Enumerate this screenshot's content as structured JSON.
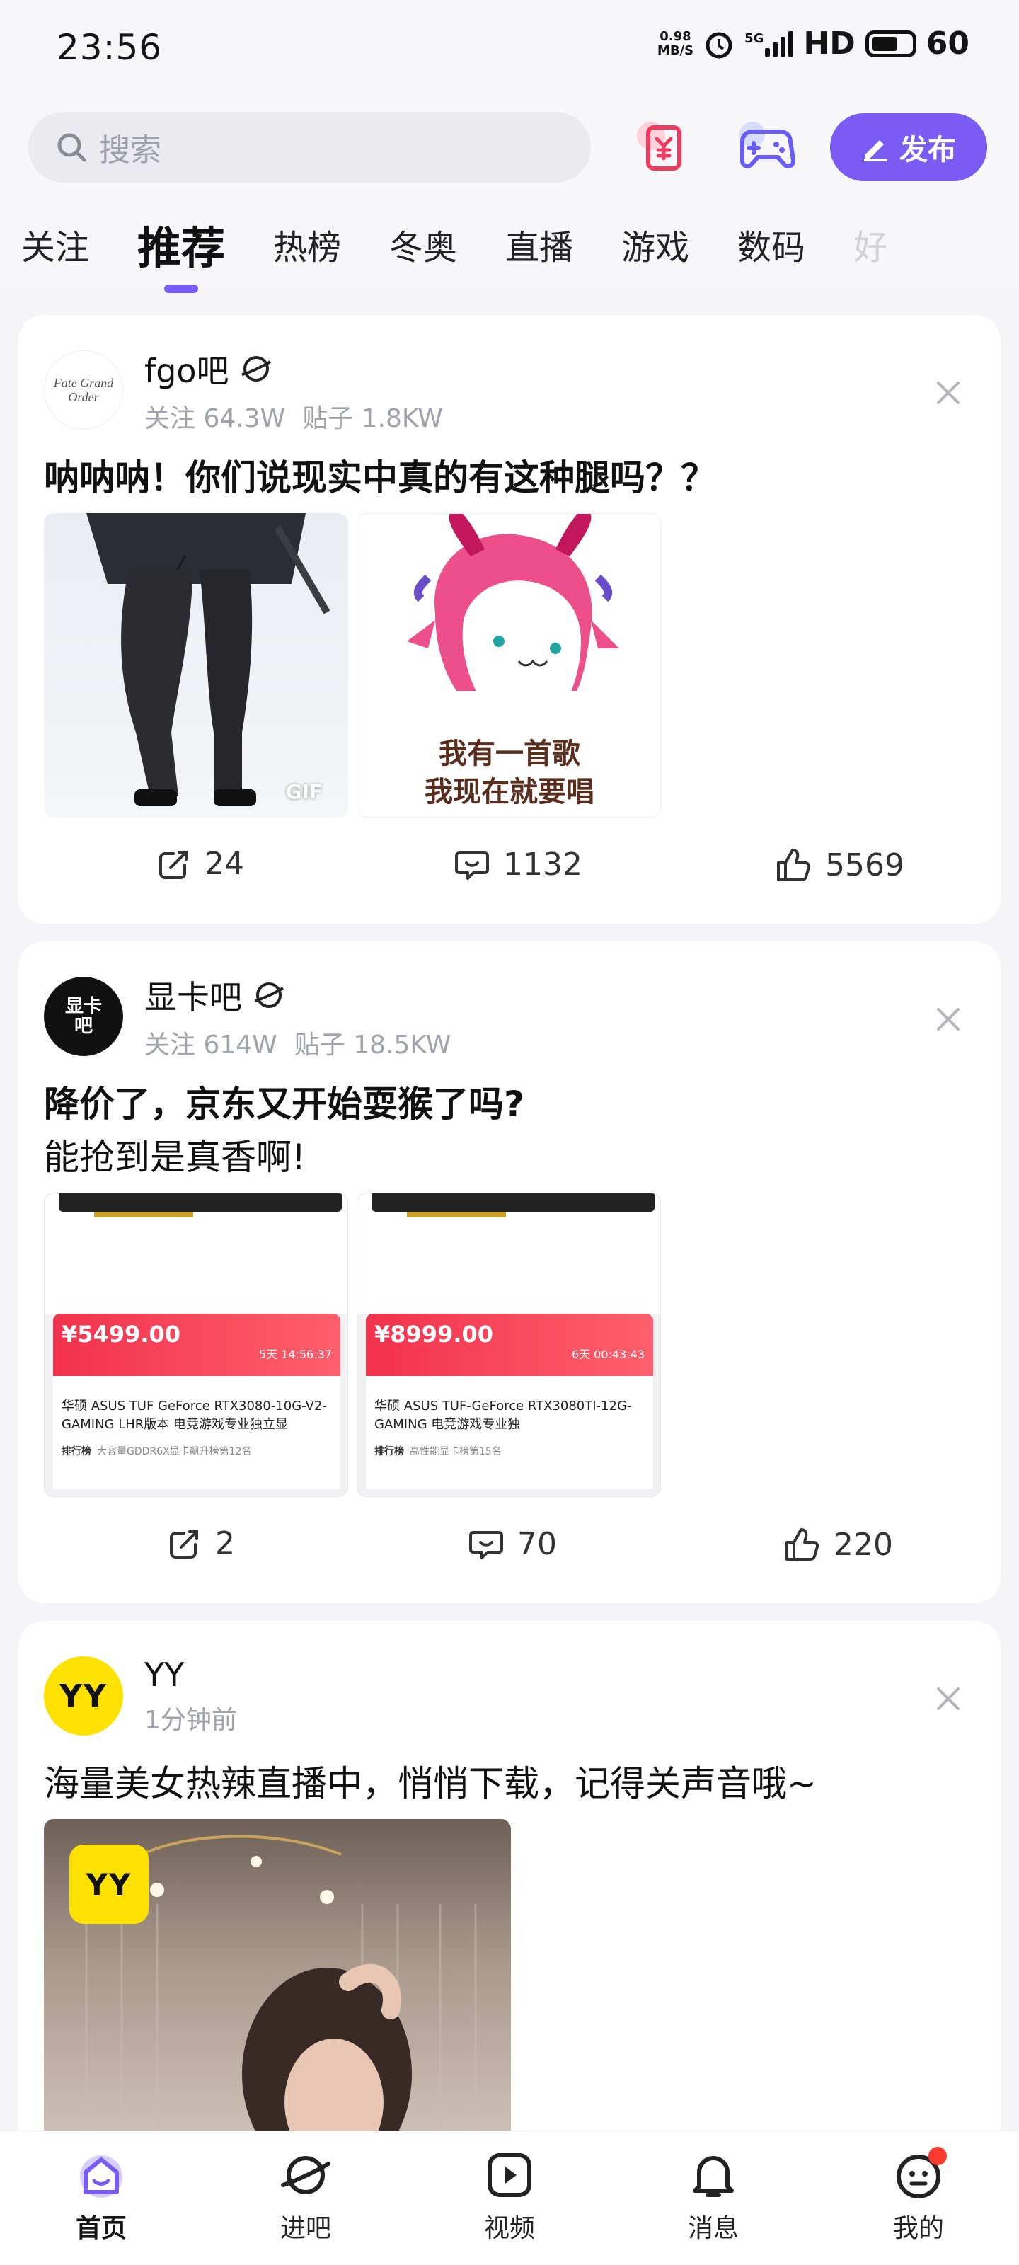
{
  "status_bar": {
    "time": "23:56",
    "net_speed_top": "0.98",
    "net_speed_bottom": "MB/S",
    "network": "5G",
    "hd": "HD",
    "battery": "60"
  },
  "header": {
    "search_placeholder": "搜索",
    "publish_label": "发布"
  },
  "tabs": [
    "关注",
    "推荐",
    "热榜",
    "冬奥",
    "直播",
    "游戏",
    "数码",
    "好"
  ],
  "active_tab": "推荐",
  "posts": [
    {
      "forum_name": "fgo吧",
      "avatar_text": "Fate Grand Order",
      "follow_label": "关注 64.3W",
      "posts_label": "贴子 1.8KW",
      "title": "呐呐呐！你们说现实中真的有这种腿吗？？",
      "gif_badge": "GIF",
      "sticker_text_1": "我有一首歌",
      "sticker_text_2": "我现在就要唱",
      "shares": "24",
      "comments": "1132",
      "likes": "5569"
    },
    {
      "forum_name": "显卡吧",
      "avatar_text": "显卡吧",
      "follow_label": "关注 614W",
      "posts_label": "贴子 18.5KW",
      "title": "降价了，京东又开始耍猴了吗?",
      "subtitle": "能抢到是真香啊!",
      "product_1": {
        "price": "¥5499.00",
        "title": "华硕 ASUS TUF GeForce RTX3080-10G-V2-GAMING LHR版本 电竞游戏专业独立显",
        "countdown": "5天 14:56:37",
        "rank": "排行榜",
        "rank_text": "大容量GDDR6X显卡飙升榜第12名"
      },
      "product_2": {
        "price": "¥8999.00",
        "title": "华硕 ASUS TUF-GeForce RTX3080TI-12G-GAMING 电竞游戏专业独",
        "countdown": "6天 00:43:43",
        "rank": "排行榜",
        "rank_text": "高性能显卡榜第15名"
      },
      "shares": "2",
      "comments": "70",
      "likes": "220"
    },
    {
      "forum_name": "YY",
      "avatar_text": "YY",
      "time_label": "1分钟前",
      "title": "海量美女热辣直播中，悄悄下载，记得关声音哦~",
      "video_logo": "YY"
    }
  ],
  "bottom_nav": [
    "首页",
    "进吧",
    "视频",
    "消息",
    "我的"
  ],
  "colors": {
    "accent": "#7a5cf5",
    "badge_red": "#ff3b30",
    "yy_yellow": "#ffe100"
  }
}
